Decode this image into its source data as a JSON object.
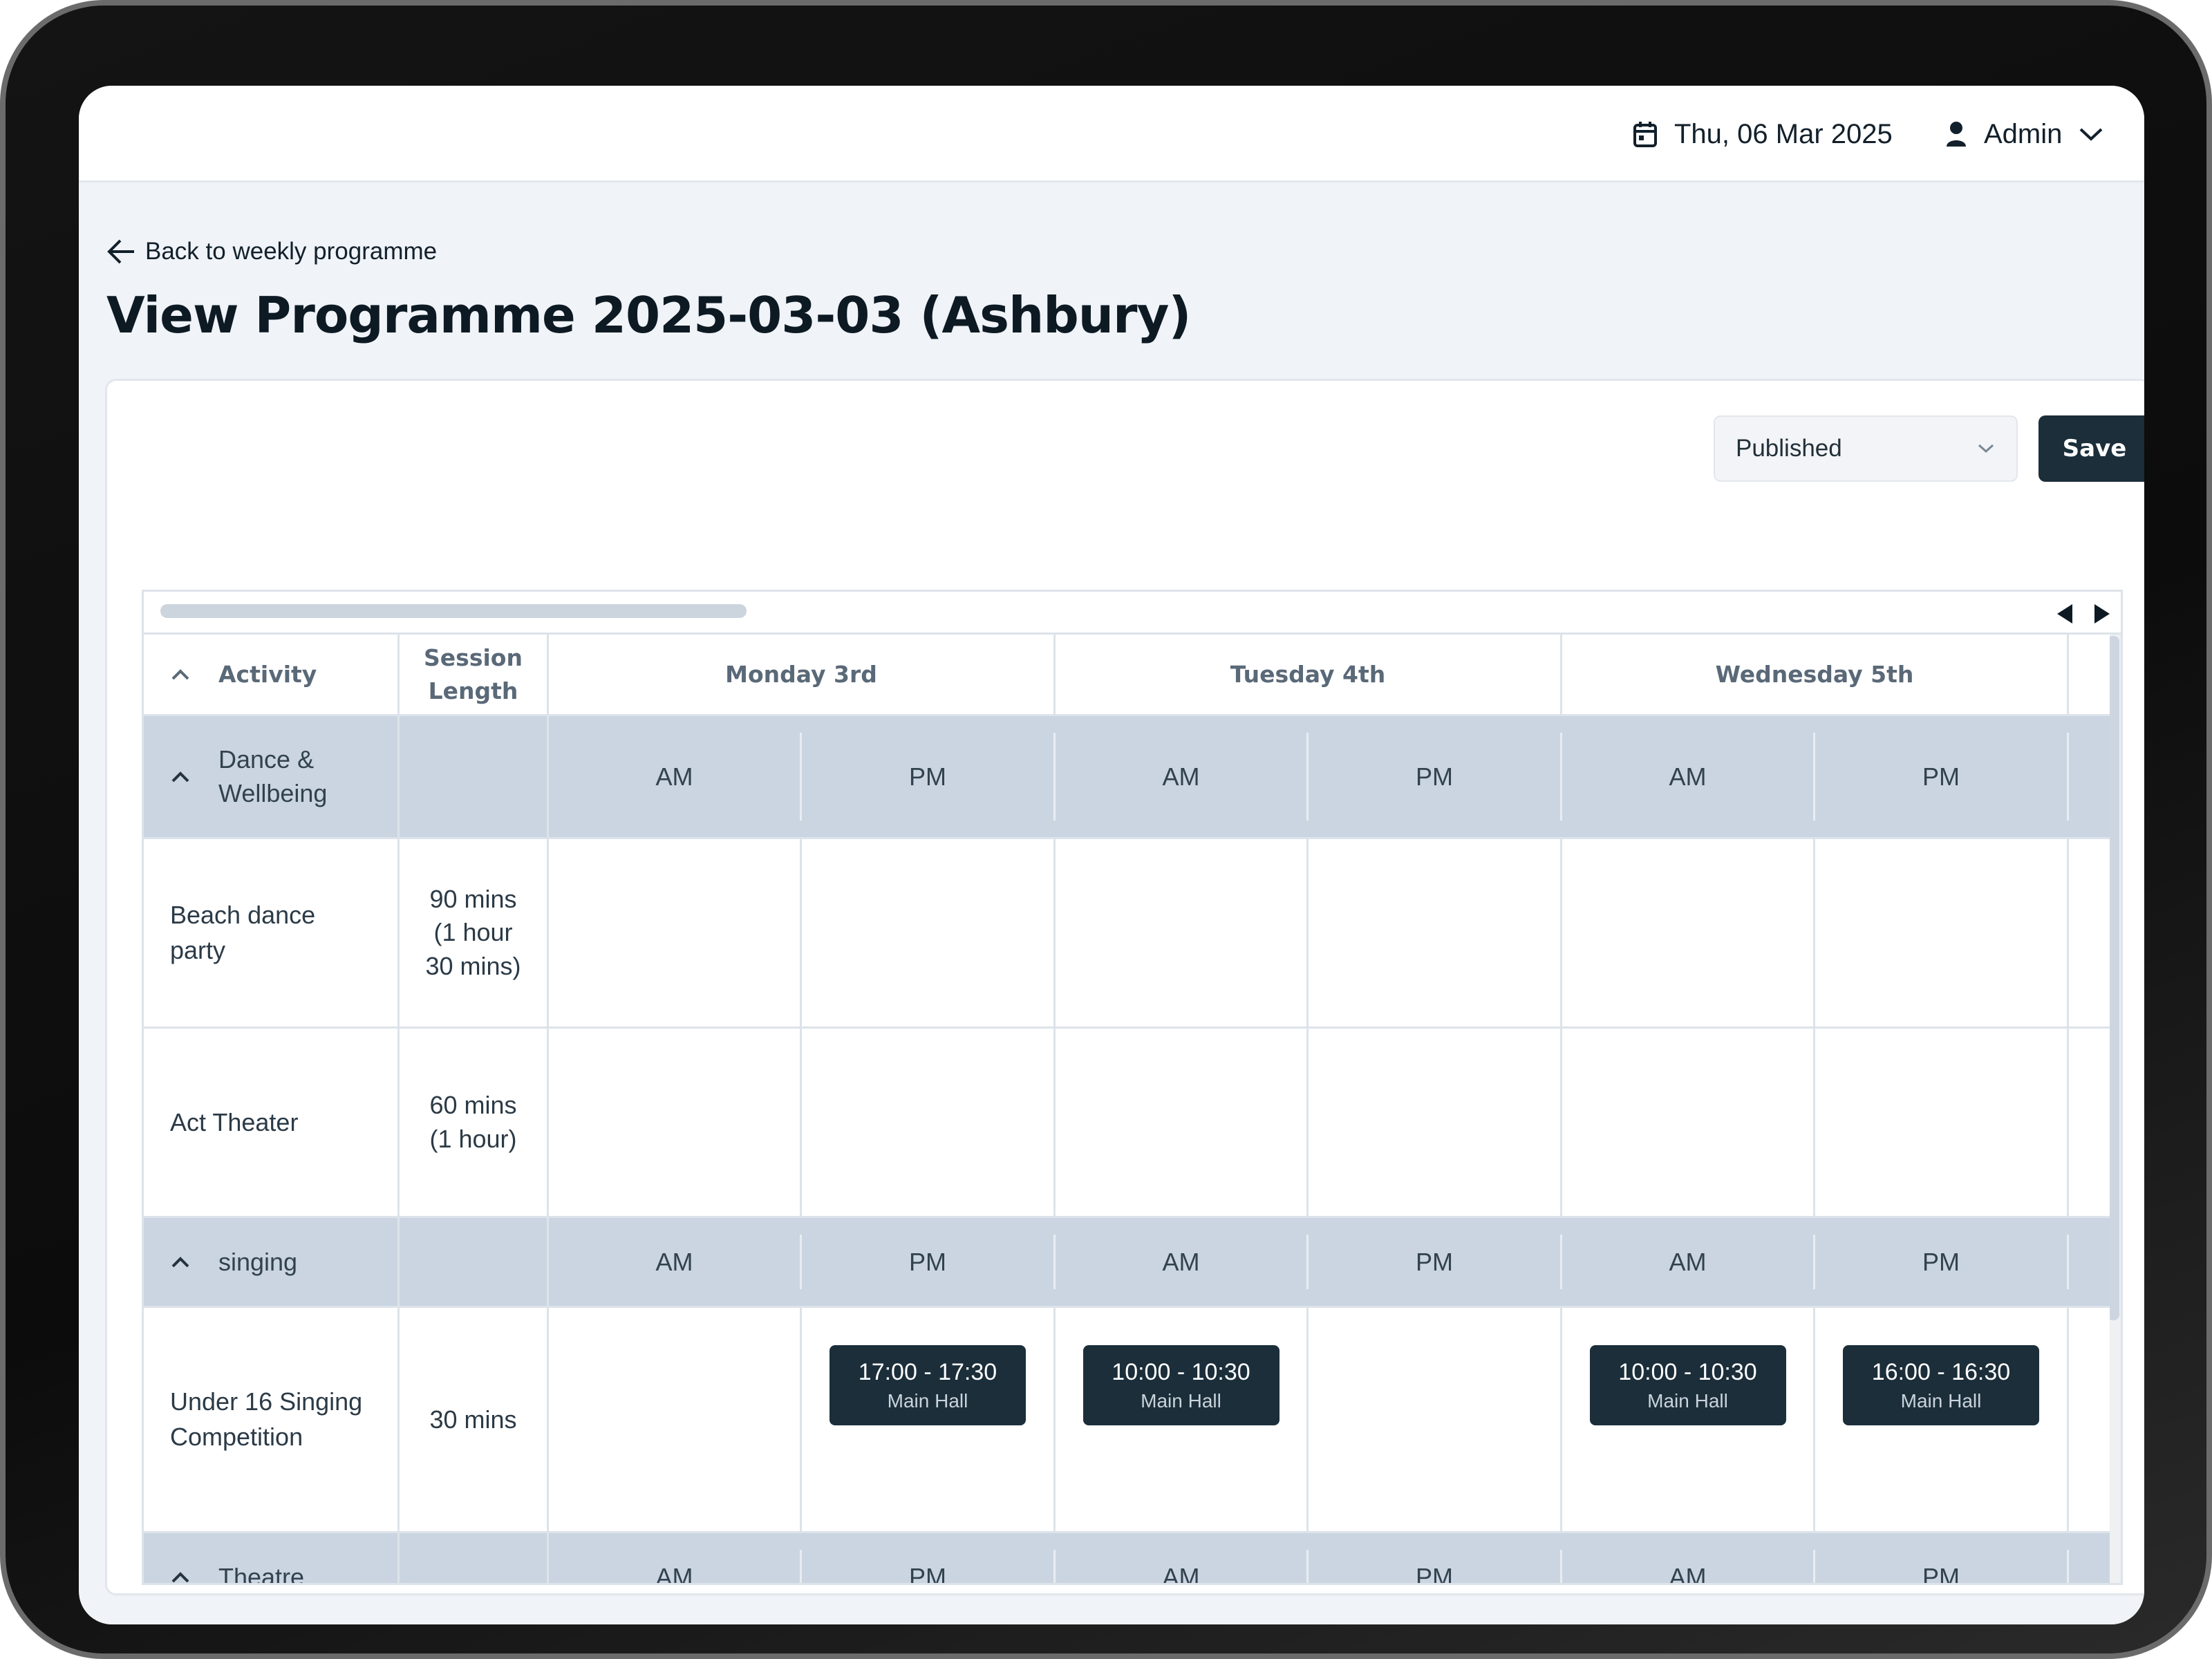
{
  "header": {
    "date": "Thu, 06 Mar 2025",
    "user": "Admin"
  },
  "page": {
    "back_label": "Back to weekly programme",
    "title": "View Programme 2025-03-03 (Ashbury)"
  },
  "toolbar": {
    "status_value": "Published",
    "save_label": "Save"
  },
  "table": {
    "columns": {
      "activity": "Activity",
      "session_length": "Session Length",
      "days": [
        "Monday 3rd",
        "Tuesday 4th",
        "Wednesday 5th"
      ]
    },
    "am": "AM",
    "pm": "PM",
    "groups": [
      {
        "name": "Dance & Wellbeing"
      },
      {
        "name": "singing"
      },
      {
        "name": "Theatre"
      }
    ],
    "rows": [
      {
        "activity": "Beach dance party",
        "length": "90 mins (1 hour 30 mins)"
      },
      {
        "activity": "Act Theater",
        "length": "60 mins (1 hour)"
      },
      {
        "activity": "Under 16 Singing Competition",
        "length": "30 mins",
        "sessions": {
          "mon_pm": {
            "time": "17:00 - 17:30",
            "room": "Main Hall"
          },
          "tue_am": {
            "time": "10:00 - 10:30",
            "room": "Main Hall"
          },
          "wed_am": {
            "time": "10:00 - 10:30",
            "room": "Main Hall"
          },
          "wed_pm": {
            "time": "16:00 - 16:30",
            "room": "Main Hall"
          }
        }
      }
    ]
  },
  "icons": {
    "calendar": "calendar-icon",
    "user": "user-icon",
    "chevron_down": "chevron-down-icon",
    "arrow_left": "arrow-left-icon",
    "chevron_up": "chevron-up-icon"
  },
  "colors": {
    "primary": "#1b2e3a",
    "group_row": "#cad5e1",
    "background": "#f0f3f7"
  }
}
